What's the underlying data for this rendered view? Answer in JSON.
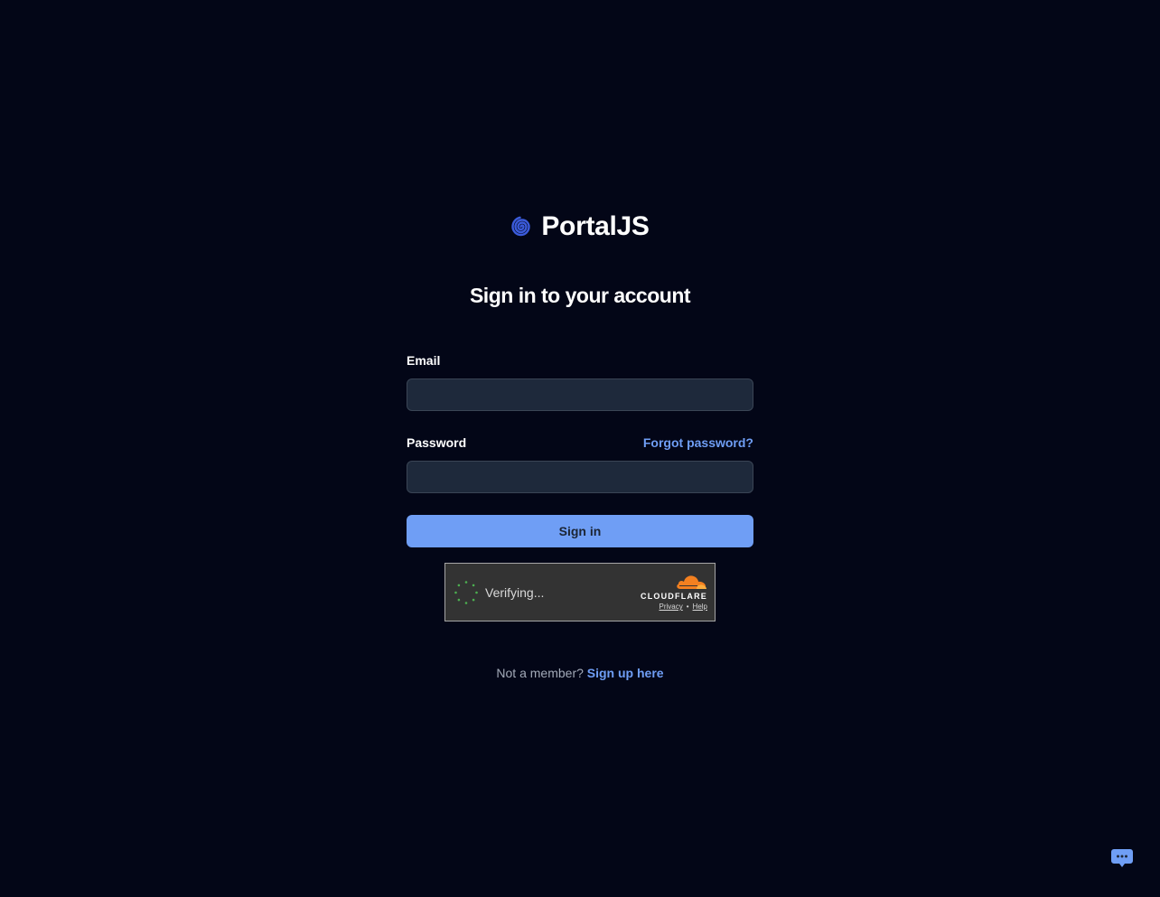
{
  "brand": {
    "name": "PortalJS",
    "logo_icon": "spiral-icon",
    "logo_color": "#3b5bdb"
  },
  "heading": "Sign in to your account",
  "form": {
    "email_label": "Email",
    "email_value": "",
    "password_label": "Password",
    "password_value": "",
    "forgot_password": "Forgot password?",
    "submit_label": "Sign in"
  },
  "captcha": {
    "status": "Verifying...",
    "provider": "CLOUDFLARE",
    "privacy_link": "Privacy",
    "separator": "•",
    "help_link": "Help"
  },
  "signup": {
    "prompt": "Not a member?",
    "link": "Sign up here"
  },
  "chat_widget": {
    "icon": "chat-bubble-icon"
  },
  "colors": {
    "background": "#030617",
    "accent": "#6f9ef5",
    "input_bg": "#1e293b",
    "cloudflare_orange": "#f38020"
  }
}
